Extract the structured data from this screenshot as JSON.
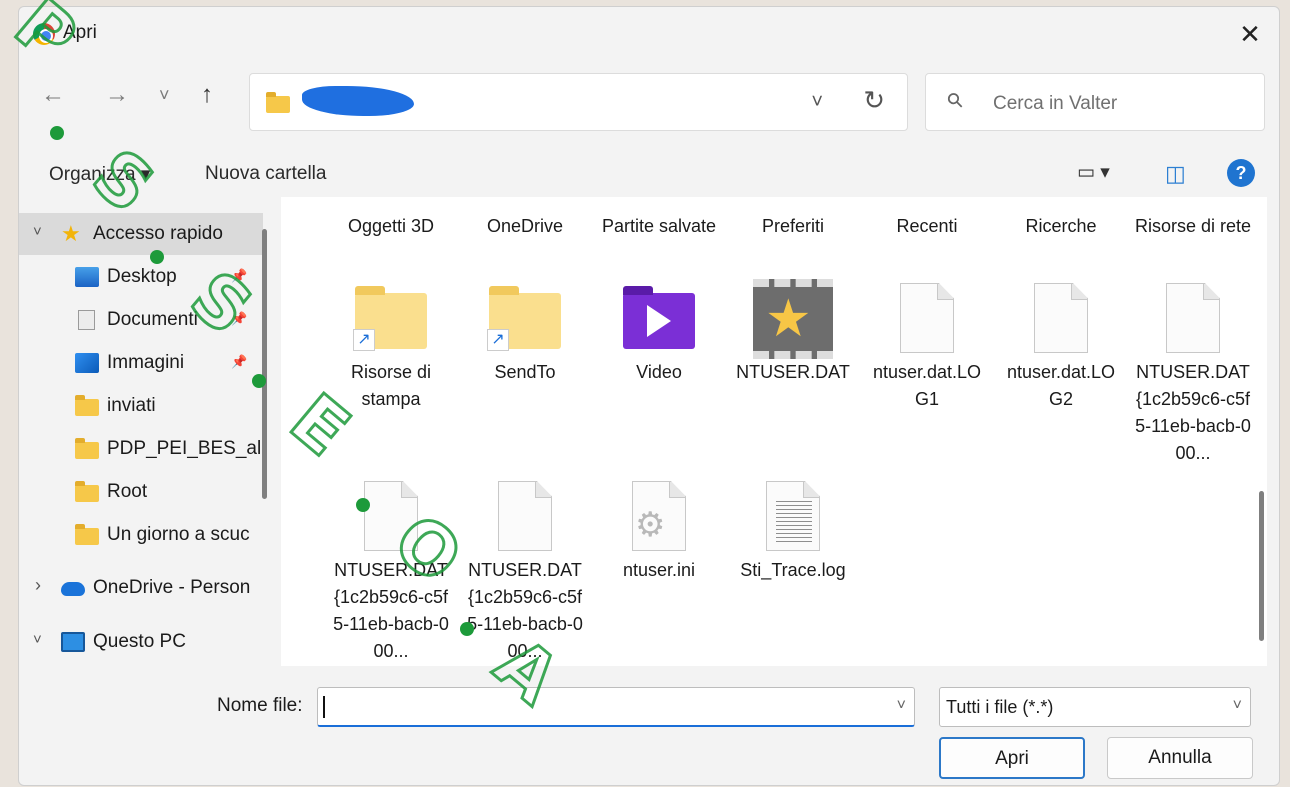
{
  "window": {
    "title": "Apri",
    "close_symbol": "✕"
  },
  "nav": {
    "back": "←",
    "forward": "→",
    "recent": "˅",
    "up": "↑",
    "address_chevron": "˅",
    "refresh": "↻"
  },
  "search": {
    "placeholder": "Cerca in Valter",
    "icon": "search-icon"
  },
  "toolbar": {
    "organize": "Organizza ▾",
    "new_folder": "Nuova cartella",
    "view_symbol": "▭ ▾",
    "pane_symbol": "◫",
    "help": "?"
  },
  "sidebar": {
    "items": [
      {
        "label": "Accesso rapido",
        "arrow": "˅",
        "icon": "star-icon"
      },
      {
        "label": "Desktop",
        "icon": "desktop-icon"
      },
      {
        "label": "Documenti",
        "icon": "document-icon"
      },
      {
        "label": "Immagini",
        "icon": "image-icon"
      },
      {
        "label": "inviati",
        "icon": "folder-icon"
      },
      {
        "label": "PDP_PEI_BES_alb",
        "icon": "folder-icon"
      },
      {
        "label": "Root",
        "icon": "folder-icon"
      },
      {
        "label": "Un giorno a scuc",
        "icon": "folder-icon"
      },
      {
        "label": "OneDrive - Person",
        "arrow": "›",
        "icon": "cloud-icon"
      },
      {
        "label": "Questo PC",
        "arrow": "˅",
        "icon": "pc-icon"
      }
    ],
    "pin": "📌"
  },
  "files": {
    "row1": [
      "Oggetti 3D",
      "OneDrive",
      "Partite salvate",
      "Preferiti",
      "Recenti",
      "Ricerche",
      "Risorse di rete"
    ],
    "row2": [
      "Risorse di stampa",
      "SendTo",
      "Video",
      "NTUSER.DAT",
      "ntuser.dat.LOG1",
      "ntuser.dat.LOG2",
      "NTUSER.DAT{1c2b59c6-c5f5-11eb-bacb-000..."
    ],
    "row3": [
      "NTUSER.DAT{1c2b59c6-c5f5-11eb-bacb-000...",
      "NTUSER.DAT{1c2b59c6-c5f5-11eb-bacb-000...",
      "ntuser.ini",
      "Sti_Trace.log"
    ],
    "shortcut_arrow": "↗"
  },
  "footer": {
    "filename_label": "Nome file:",
    "filename_value": "",
    "filter": "Tutti i file (*.*)",
    "open": "Apri",
    "cancel": "Annulla",
    "chevron": "˅"
  },
  "watermark": {
    "letters": [
      "P",
      "S",
      "S",
      "E",
      "O",
      "A"
    ]
  }
}
